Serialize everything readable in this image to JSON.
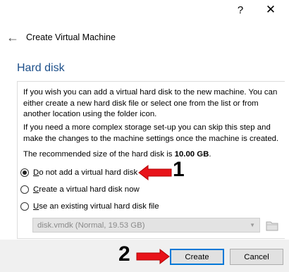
{
  "titlebar": {
    "help_label": "?",
    "close_label": "✕"
  },
  "header": {
    "back_label": "←",
    "title": "Create Virtual Machine"
  },
  "section": {
    "title": "Hard disk"
  },
  "description": {
    "para1": "If you wish you can add a virtual hard disk to the new machine. You can either create a new hard disk file or select one from the list or from another location using the folder icon.",
    "para2": "If you need a more complex storage set-up you can skip this step and make the changes to the machine settings once the machine is created.",
    "recommended_prefix": "The recommended size of the hard disk is ",
    "recommended_size": "10.00 GB",
    "recommended_suffix": "."
  },
  "options": {
    "no_disk": {
      "mnemonic": "D",
      "rest": "o not add a virtual hard disk",
      "selected": true
    },
    "create_now": {
      "mnemonic": "C",
      "rest": "reate a virtual hard disk now",
      "selected": false
    },
    "use_existing": {
      "mnemonic": "U",
      "rest": "se an existing virtual hard disk file",
      "selected": false
    }
  },
  "disk_select": {
    "value": "disk.vmdk (Normal, 19.53 GB)",
    "enabled": false
  },
  "buttons": {
    "create": "Create",
    "cancel": "Cancel"
  },
  "annotations": {
    "step1": "1",
    "step2": "2",
    "arrow_color": "#e8131a"
  },
  "colors": {
    "section_title": "#1c4f8a",
    "focus_border": "#0078d7"
  }
}
